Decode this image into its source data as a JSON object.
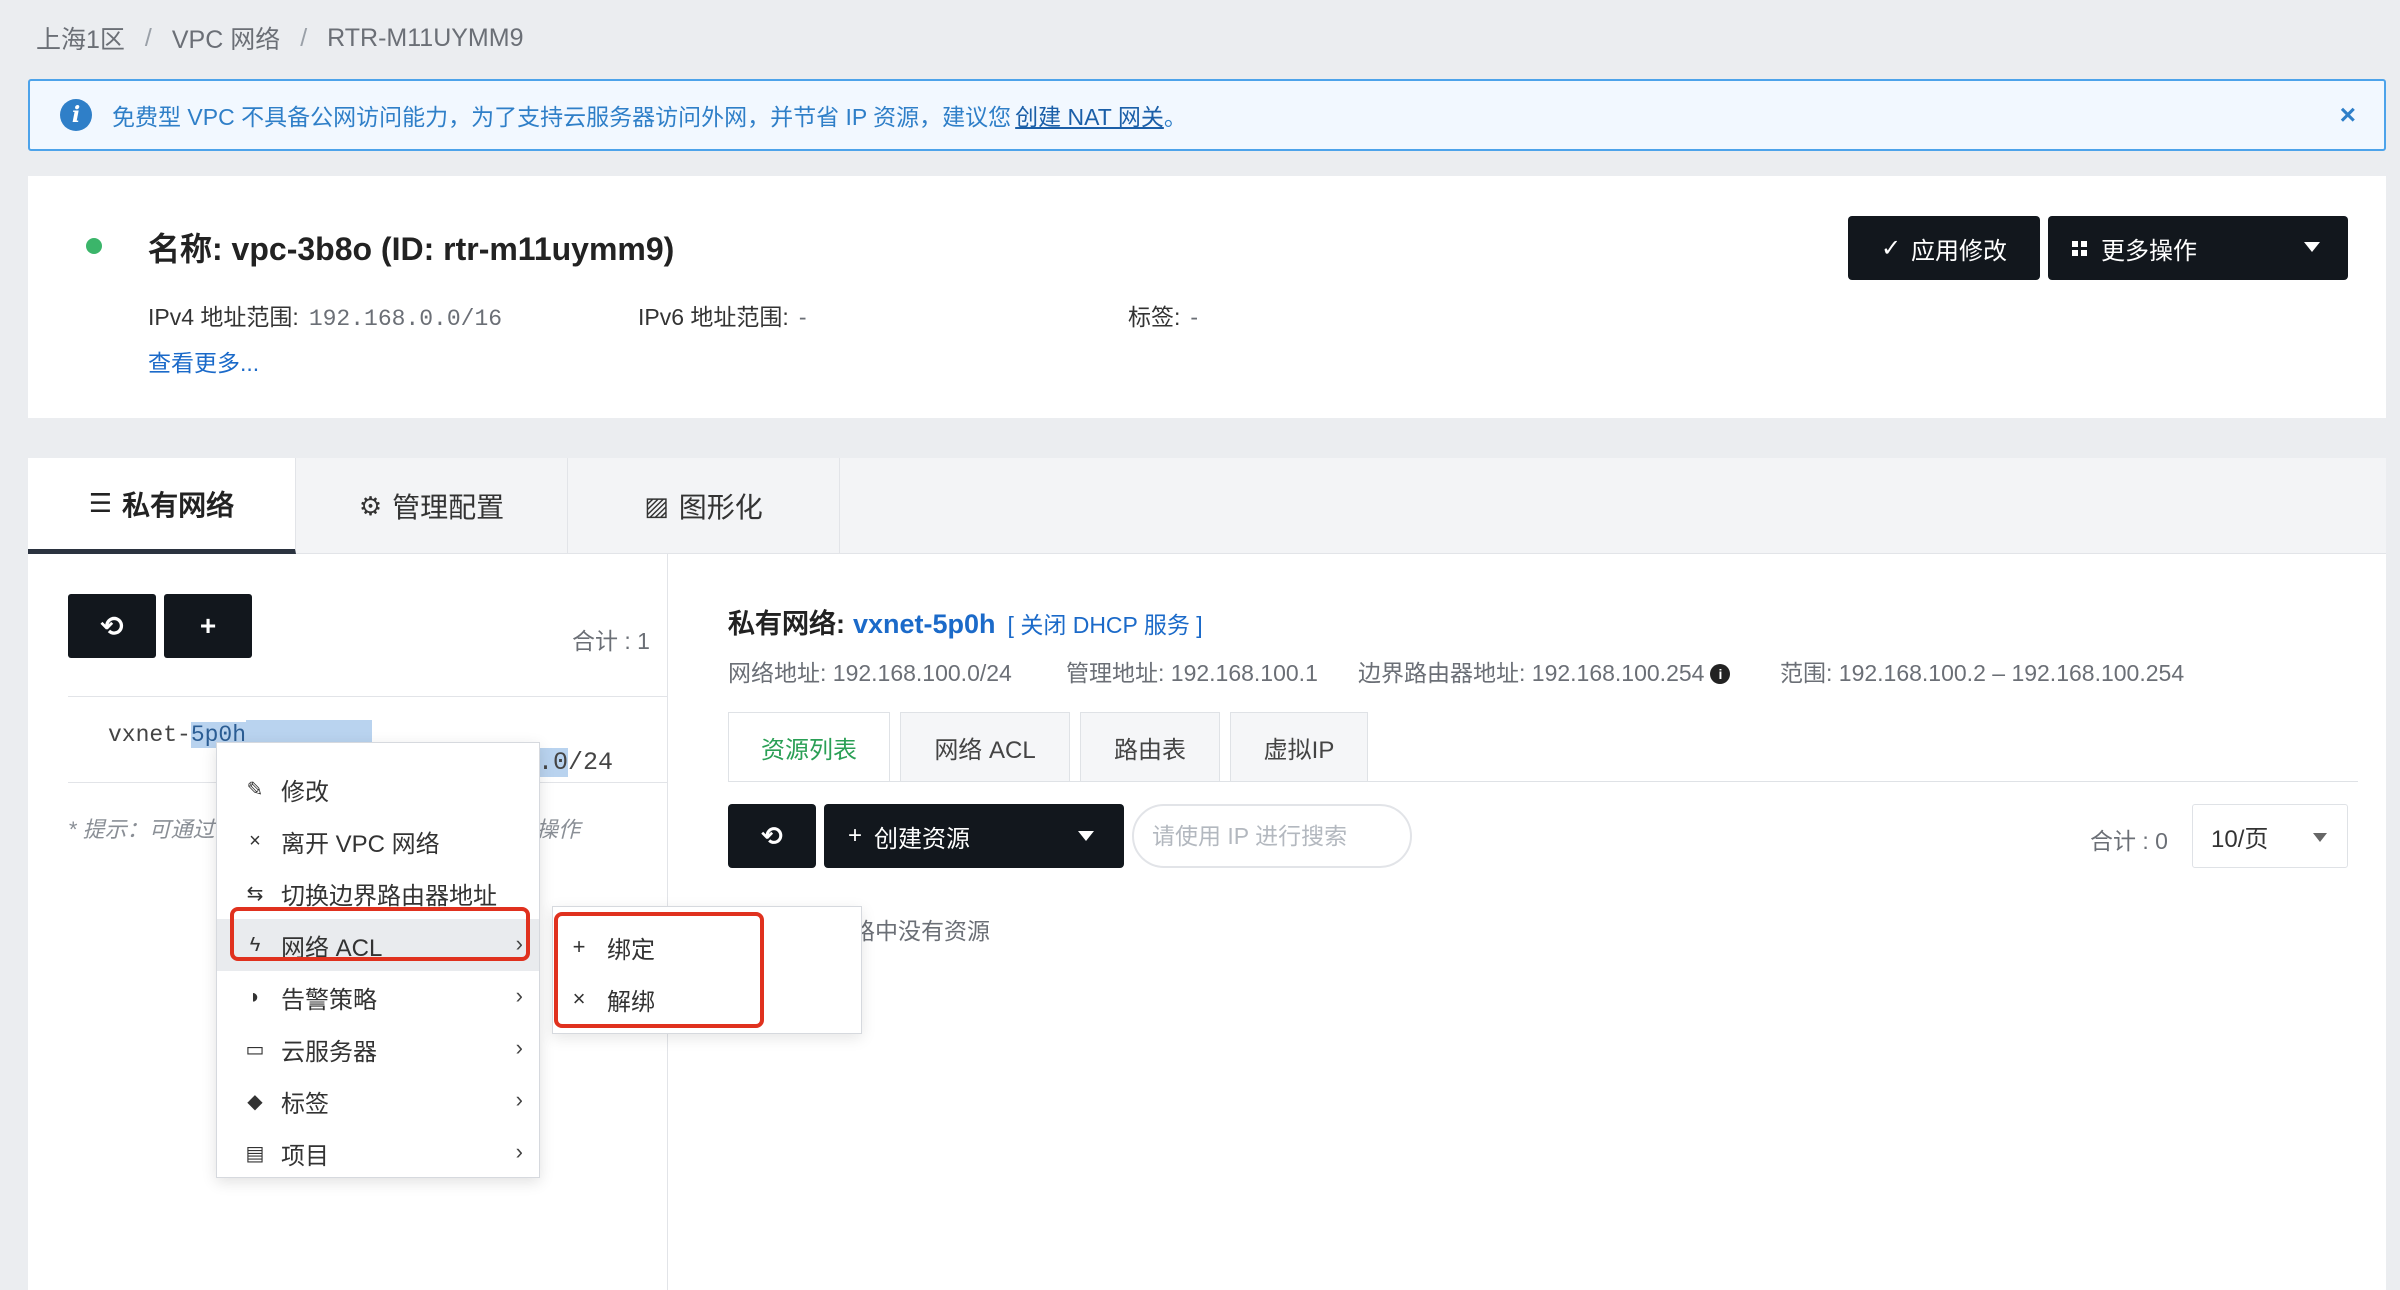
{
  "breadcrumb": [
    "上海1区",
    "VPC 网络",
    "RTR-M11UYMM9"
  ],
  "notice": {
    "text": "免费型 VPC 不具备公网访问能力，为了支持云服务器访问外网，并节省 IP 资源，建议您",
    "link": "创建 NAT 网关",
    "suffix": "。",
    "close": "×"
  },
  "summary": {
    "title": "名称: vpc-3b8o (ID: rtr-m11uymm9)",
    "ipv4_label": "IPv4 地址范围:",
    "ipv4_value": "192.168.0.0/16",
    "ipv6_label": "IPv6 地址范围:",
    "ipv6_value": "-",
    "tags_label": "标签:",
    "tags_value": "-",
    "see_more": "查看更多...",
    "apply_button": "应用修改",
    "more_button": "更多操作",
    "status_color": "#3bb56a"
  },
  "top_tabs": [
    {
      "label": "私有网络",
      "icon": "list-icon"
    },
    {
      "label": "管理配置",
      "icon": "gears-icon"
    },
    {
      "label": "图形化",
      "icon": "image-icon"
    }
  ],
  "left": {
    "count": "合计 : 1",
    "vxnet_prefix": "vxnet-",
    "vxnet_highlight": "5p0h",
    "cidr": ".0/24",
    "tip": "* 提示：可通过",
    "tip_tail": "操作"
  },
  "detail": {
    "label": "私有网络:",
    "vxnet": "vxnet-5p0h",
    "dhcp": "[ 关闭 DHCP 服务 ]",
    "net_addr": "网络地址: 192.168.100.0/24",
    "mgmt_addr": "管理地址: 192.168.100.1",
    "border_addr": "边界路由器地址: 192.168.100.254",
    "range": "范围: 192.168.100.2 – 192.168.100.254"
  },
  "sub_tabs": [
    "资源列表",
    "网络 ACL",
    "路由表",
    "虚拟IP"
  ],
  "toolbar": {
    "create": "创建资源",
    "search_placeholder": "请使用 IP 进行搜索",
    "count": "合计 : 0",
    "page_size": "10/页"
  },
  "empty": "路中没有资源",
  "context_menu": [
    {
      "label": "修改",
      "icon": "pencil-icon",
      "glyph": "✎"
    },
    {
      "label": "离开 VPC 网络",
      "icon": "close-icon",
      "glyph": "×"
    },
    {
      "label": "切换边界路由器地址",
      "icon": "swap-icon",
      "glyph": "⇆"
    },
    {
      "label": "网络 ACL",
      "icon": "bolt-icon",
      "glyph": "ϟ",
      "submenu": true
    },
    {
      "label": "告警策略",
      "icon": "bell-icon",
      "glyph": "◗",
      "submenu": true
    },
    {
      "label": "云服务器",
      "icon": "monitor-icon",
      "glyph": "▭",
      "submenu": true
    },
    {
      "label": "标签",
      "icon": "tags-icon",
      "glyph": "◆",
      "submenu": true
    },
    {
      "label": "项目",
      "icon": "archive-icon",
      "glyph": "▤",
      "submenu": true
    }
  ],
  "sub_menu": [
    {
      "label": "绑定",
      "icon": "plus-icon",
      "glyph": "+"
    },
    {
      "label": "解绑",
      "icon": "close-icon",
      "glyph": "×"
    }
  ],
  "highlight_color": "#e0311e"
}
